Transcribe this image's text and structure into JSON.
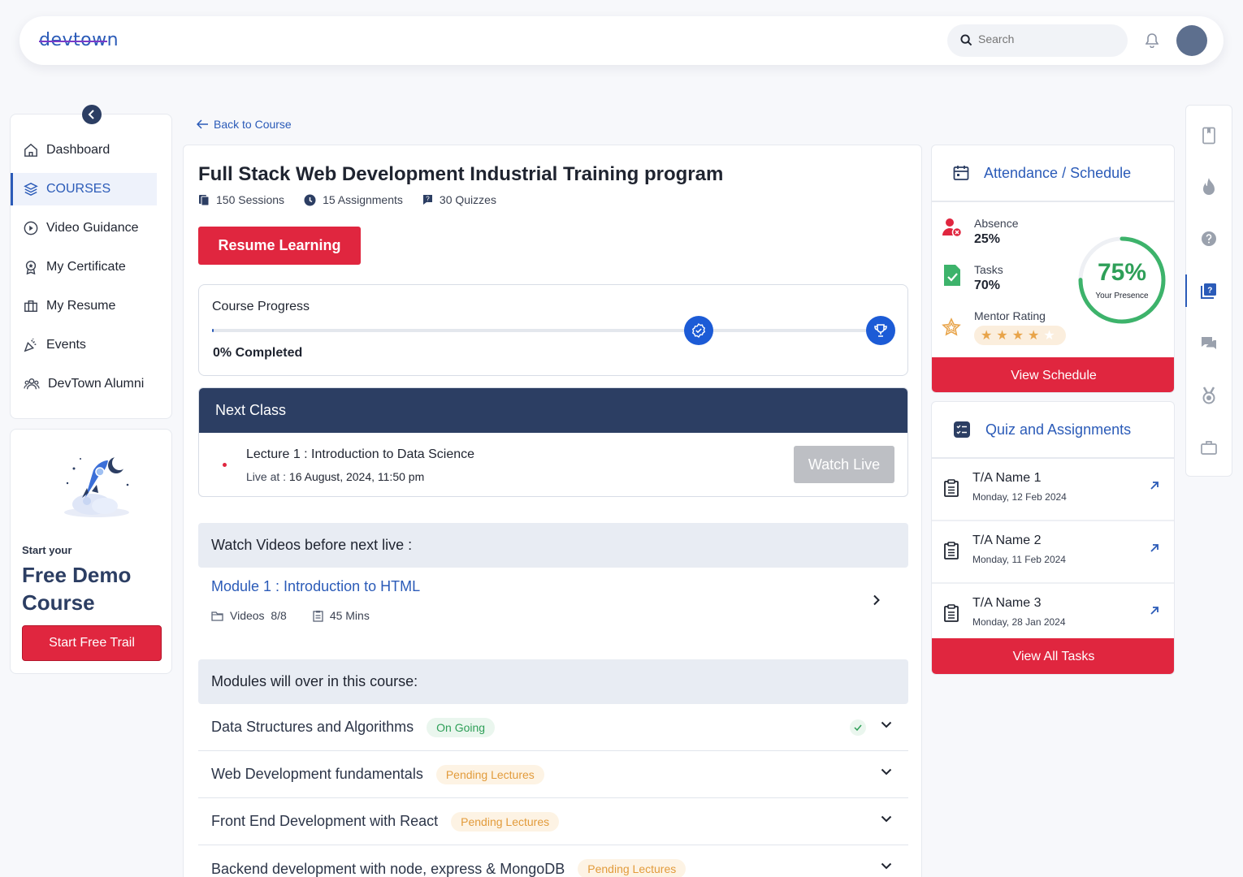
{
  "header": {
    "logo": "devtown",
    "search_placeholder": "Search"
  },
  "sidebar": {
    "items": [
      {
        "label": "Dashboard",
        "icon": "home-icon"
      },
      {
        "label": "COURSES",
        "icon": "layers-icon",
        "active": true
      },
      {
        "label": "Video Guidance",
        "icon": "play-circle-icon"
      },
      {
        "label": "My Certificate",
        "icon": "award-icon"
      },
      {
        "label": "My Resume",
        "icon": "briefcase-icon"
      },
      {
        "label": "Events",
        "icon": "party-icon"
      },
      {
        "label": "DevTown Alumni",
        "icon": "group-icon"
      }
    ]
  },
  "promo": {
    "small": "Start your",
    "big": "Free Demo Course",
    "button": "Start Free Trail"
  },
  "back_link": "Back to Course",
  "course": {
    "title": "Full Stack Web Development Industrial Training program",
    "sessions": "150 Sessions",
    "assignments": "15 Assignments",
    "quizzes": "30 Quizzes",
    "resume_button": "Resume Learning"
  },
  "progress": {
    "label": "Course Progress",
    "value": 0,
    "completed_text": "0% Completed"
  },
  "next_class": {
    "header": "Next Class",
    "lecture": "Lecture 1 : Introduction to Data Science",
    "live_prefix": "Live at : ",
    "live_time": "16 August, 2024, 11:50 pm",
    "watch_button": "Watch Live"
  },
  "videos": {
    "header": "Watch Videos before next live :",
    "module": "Module 1 : Introduction to HTML",
    "videos_label": "Videos",
    "videos_count": "8/8",
    "duration": "45 Mins"
  },
  "modules": {
    "header": "Modules will over in this course:",
    "items": [
      {
        "name": "Data Structures and Algorithms",
        "status": "On Going"
      },
      {
        "name": "Web Development fundamentals",
        "status": "Pending Lectures"
      },
      {
        "name": "Front End Development with React",
        "status": "Pending Lectures"
      },
      {
        "name": "Backend development with node, express & MongoDB",
        "status": "Pending Lectures"
      }
    ]
  },
  "attendance": {
    "title": "Attendance / Schedule",
    "absence_label": "Absence",
    "absence_value": "25%",
    "tasks_label": "Tasks",
    "tasks_value": "70%",
    "mentor_label": "Mentor Rating",
    "mentor_rating": 4,
    "presence_value": 75,
    "presence_text": "75%",
    "presence_label": "Your Presence",
    "button": "View Schedule"
  },
  "quiz": {
    "title": "Quiz and Assignments",
    "items": [
      {
        "name": "T/A Name 1",
        "date": "Monday, 12 Feb 2024"
      },
      {
        "name": "T/A Name 2",
        "date": "Monday, 11 Feb 2024"
      },
      {
        "name": "T/A Name 3",
        "date": "Monday, 28 Jan 2024"
      }
    ],
    "button": "View All Tasks"
  },
  "colors": {
    "accent_blue": "#2b5bb8",
    "brand_red": "#e0263f",
    "navy": "#2c3e63",
    "success_green": "#2e9f58",
    "pending_orange": "#e29b3b"
  }
}
